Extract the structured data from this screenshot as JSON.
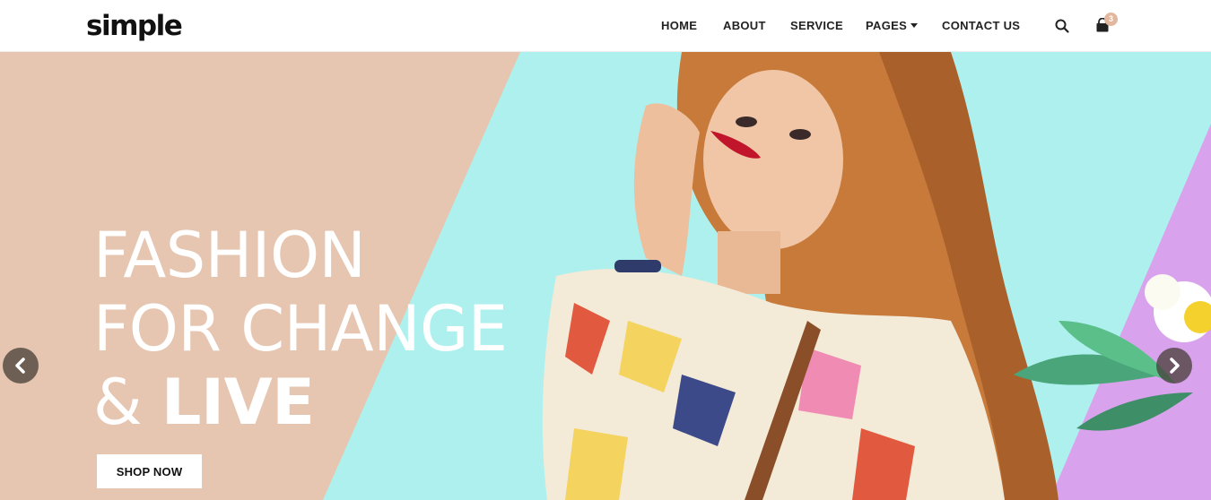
{
  "brand": {
    "logo_text": "simple"
  },
  "nav": {
    "items": [
      {
        "label": "HOME"
      },
      {
        "label": "ABOUT"
      },
      {
        "label": "SERVICE"
      },
      {
        "label": "PAGES"
      },
      {
        "label": "CONTACT US"
      }
    ],
    "search_icon": "search-icon",
    "cart_icon": "shopping-bag-icon",
    "cart_count": "3"
  },
  "hero": {
    "line1": "FASHION",
    "line2": "FOR CHANGE",
    "line3_prefix": "& ",
    "line3_bold": "LIVE",
    "cta_label": "SHOP NOW",
    "prev_icon": "chevron-left-icon",
    "next_icon": "chevron-right-icon"
  },
  "colors": {
    "peach": "#e6c6b0",
    "aqua": "#aef0ee",
    "lilac": "#d9a2ec",
    "badge": "#e2b79d"
  }
}
